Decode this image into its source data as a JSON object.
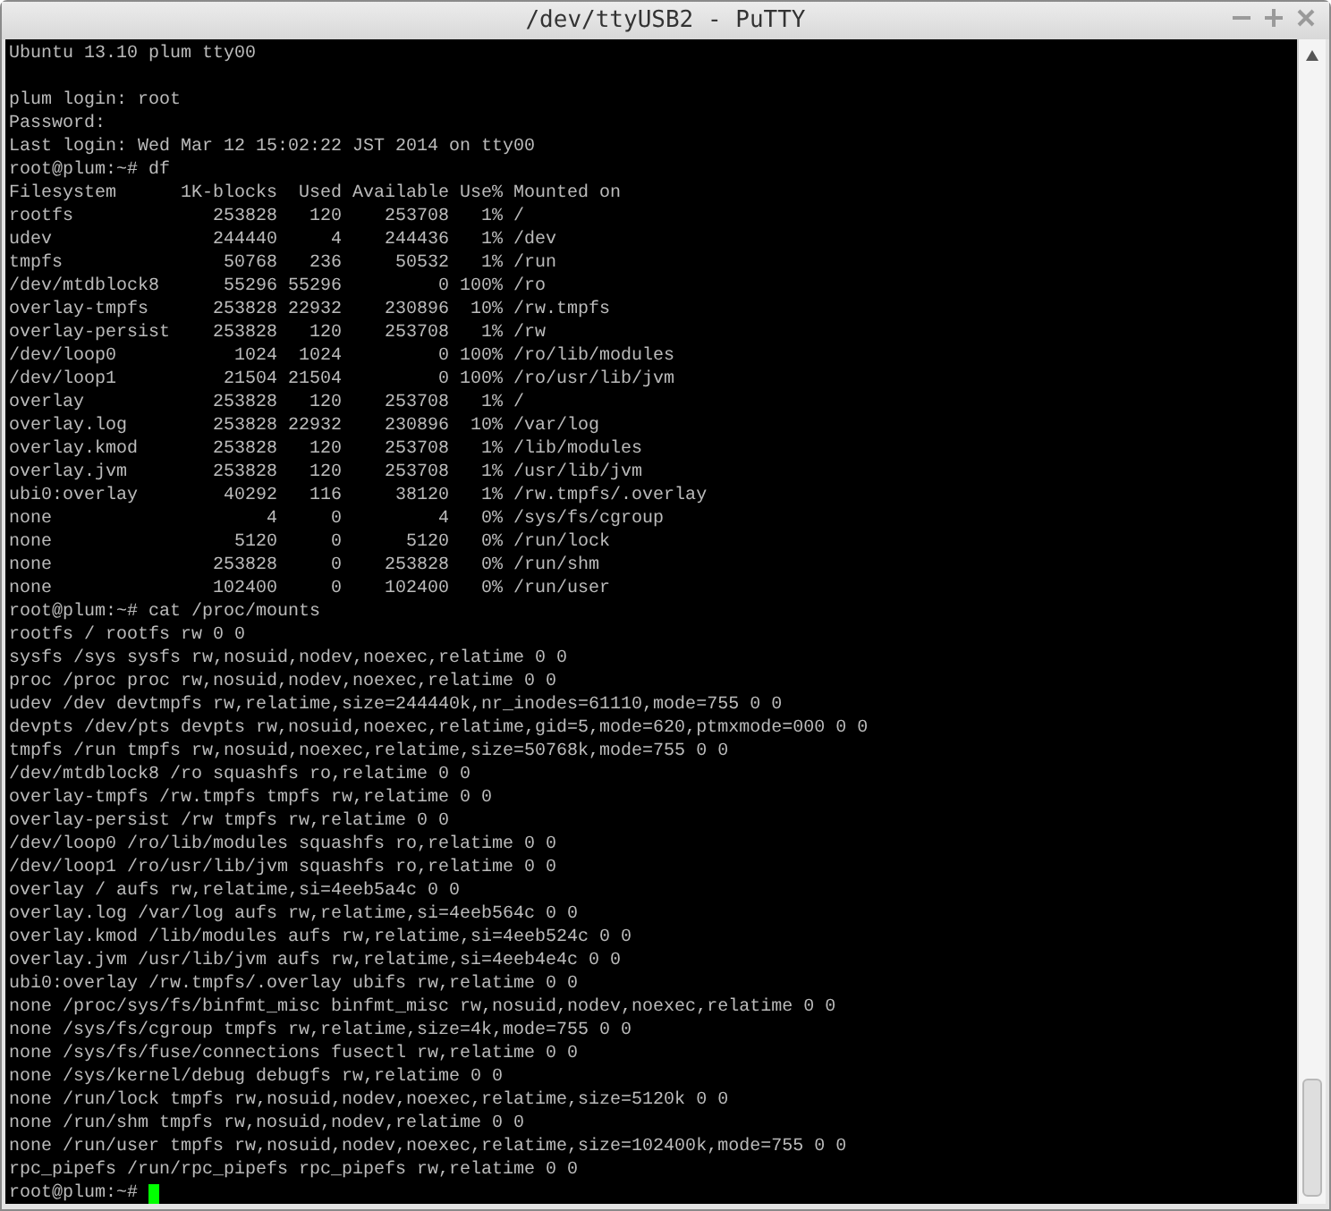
{
  "window": {
    "title": "/dev/ttyUSB2 - PuTTY"
  },
  "terminal": {
    "lines": [
      {
        "kind": "text",
        "text": "Ubuntu 13.10 plum tty00"
      },
      {
        "kind": "blank"
      },
      {
        "kind": "text",
        "text": "plum login: root"
      },
      {
        "kind": "text",
        "text": "Password:"
      },
      {
        "kind": "text",
        "text": "Last login: Wed Mar 12 15:02:22 JST 2014 on tty00"
      },
      {
        "kind": "text",
        "text": "root@plum:~# df"
      },
      {
        "kind": "text",
        "text": "Filesystem      1K-blocks  Used Available Use% Mounted on"
      },
      {
        "kind": "text",
        "text": "rootfs             253828   120    253708   1% /"
      },
      {
        "kind": "text",
        "text": "udev               244440     4    244436   1% /dev"
      },
      {
        "kind": "text",
        "text": "tmpfs               50768   236     50532   1% /run"
      },
      {
        "kind": "text",
        "text": "/dev/mtdblock8      55296 55296         0 100% /ro"
      },
      {
        "kind": "text",
        "text": "overlay-tmpfs      253828 22932    230896  10% /rw.tmpfs"
      },
      {
        "kind": "text",
        "text": "overlay-persist    253828   120    253708   1% /rw"
      },
      {
        "kind": "text",
        "text": "/dev/loop0           1024  1024         0 100% /ro/lib/modules"
      },
      {
        "kind": "text",
        "text": "/dev/loop1          21504 21504         0 100% /ro/usr/lib/jvm"
      },
      {
        "kind": "text",
        "text": "overlay            253828   120    253708   1% /"
      },
      {
        "kind": "text",
        "text": "overlay.log        253828 22932    230896  10% /var/log"
      },
      {
        "kind": "text",
        "text": "overlay.kmod       253828   120    253708   1% /lib/modules"
      },
      {
        "kind": "text",
        "text": "overlay.jvm        253828   120    253708   1% /usr/lib/jvm"
      },
      {
        "kind": "text",
        "text": "ubi0:overlay        40292   116     38120   1% /rw.tmpfs/.overlay"
      },
      {
        "kind": "text",
        "text": "none                    4     0         4   0% /sys/fs/cgroup"
      },
      {
        "kind": "text",
        "text": "none                 5120     0      5120   0% /run/lock"
      },
      {
        "kind": "text",
        "text": "none               253828     0    253828   0% /run/shm"
      },
      {
        "kind": "text",
        "text": "none               102400     0    102400   0% /run/user"
      },
      {
        "kind": "text",
        "text": "root@plum:~# cat /proc/mounts"
      },
      {
        "kind": "text",
        "text": "rootfs / rootfs rw 0 0"
      },
      {
        "kind": "text",
        "text": "sysfs /sys sysfs rw,nosuid,nodev,noexec,relatime 0 0"
      },
      {
        "kind": "text",
        "text": "proc /proc proc rw,nosuid,nodev,noexec,relatime 0 0"
      },
      {
        "kind": "text",
        "text": "udev /dev devtmpfs rw,relatime,size=244440k,nr_inodes=61110,mode=755 0 0"
      },
      {
        "kind": "text",
        "text": "devpts /dev/pts devpts rw,nosuid,noexec,relatime,gid=5,mode=620,ptmxmode=000 0 0"
      },
      {
        "kind": "text",
        "text": "tmpfs /run tmpfs rw,nosuid,noexec,relatime,size=50768k,mode=755 0 0"
      },
      {
        "kind": "text",
        "text": "/dev/mtdblock8 /ro squashfs ro,relatime 0 0"
      },
      {
        "kind": "text",
        "text": "overlay-tmpfs /rw.tmpfs tmpfs rw,relatime 0 0"
      },
      {
        "kind": "text",
        "text": "overlay-persist /rw tmpfs rw,relatime 0 0"
      },
      {
        "kind": "text",
        "text": "/dev/loop0 /ro/lib/modules squashfs ro,relatime 0 0"
      },
      {
        "kind": "text",
        "text": "/dev/loop1 /ro/usr/lib/jvm squashfs ro,relatime 0 0"
      },
      {
        "kind": "text",
        "text": "overlay / aufs rw,relatime,si=4eeb5a4c 0 0"
      },
      {
        "kind": "text",
        "text": "overlay.log /var/log aufs rw,relatime,si=4eeb564c 0 0"
      },
      {
        "kind": "text",
        "text": "overlay.kmod /lib/modules aufs rw,relatime,si=4eeb524c 0 0"
      },
      {
        "kind": "text",
        "text": "overlay.jvm /usr/lib/jvm aufs rw,relatime,si=4eeb4e4c 0 0"
      },
      {
        "kind": "text",
        "text": "ubi0:overlay /rw.tmpfs/.overlay ubifs rw,relatime 0 0"
      },
      {
        "kind": "text",
        "text": "none /proc/sys/fs/binfmt_misc binfmt_misc rw,nosuid,nodev,noexec,relatime 0 0"
      },
      {
        "kind": "text",
        "text": "none /sys/fs/cgroup tmpfs rw,relatime,size=4k,mode=755 0 0"
      },
      {
        "kind": "text",
        "text": "none /sys/fs/fuse/connections fusectl rw,relatime 0 0"
      },
      {
        "kind": "text",
        "text": "none /sys/kernel/debug debugfs rw,relatime 0 0"
      },
      {
        "kind": "text",
        "text": "none /run/lock tmpfs rw,nosuid,nodev,noexec,relatime,size=5120k 0 0"
      },
      {
        "kind": "text",
        "text": "none /run/shm tmpfs rw,nosuid,nodev,relatime 0 0"
      },
      {
        "kind": "text",
        "text": "none /run/user tmpfs rw,nosuid,nodev,noexec,relatime,size=102400k,mode=755 0 0"
      },
      {
        "kind": "text",
        "text": "rpc_pipefs /run/rpc_pipefs rpc_pipefs rw,relatime 0 0"
      },
      {
        "kind": "prompt",
        "text": "root@plum:~# "
      }
    ]
  }
}
